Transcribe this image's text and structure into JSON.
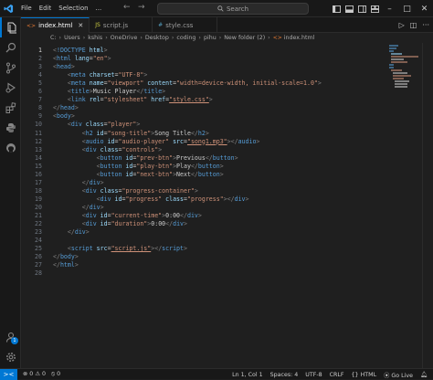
{
  "titlebar": {
    "menu": [
      "File",
      "Edit",
      "Selection"
    ],
    "more_label": "...",
    "back_label": "←",
    "forward_label": "→",
    "search_label": "Search"
  },
  "tabs": [
    {
      "label": "index.html",
      "icon": "<>",
      "icon_color": "#e37933",
      "active": true
    },
    {
      "label": "script.js",
      "icon": "JS",
      "icon_color": "#cbcb41",
      "active": false
    },
    {
      "label": "style.css",
      "icon": "#",
      "icon_color": "#519aba",
      "active": false
    }
  ],
  "breadcrumb": {
    "parts": [
      "C:",
      "Users",
      "kshis",
      "OneDrive",
      "Desktop",
      "coding",
      "pihu",
      "New folder (2)"
    ],
    "file_icon": "<>",
    "file": "index.html"
  },
  "editor": {
    "cursor_line": 1,
    "line_numbers": [
      "1",
      "2",
      "3",
      "4",
      "5",
      "6",
      "7",
      "8",
      "9",
      "10",
      "11",
      "12",
      "13",
      "14",
      "15",
      "16",
      "17",
      "18",
      "19",
      "20",
      "21",
      "22",
      "23",
      "24",
      "25",
      "26",
      "27",
      "28"
    ],
    "lines": [
      [
        {
          "k": "t-punc",
          "t": "<"
        },
        {
          "k": "t-doc",
          "t": "!DOCTYPE"
        },
        {
          "k": "t-attr",
          "t": " html"
        },
        {
          "k": "t-punc",
          "t": ">"
        }
      ],
      [
        {
          "k": "t-punc",
          "t": "<"
        },
        {
          "k": "t-tag",
          "t": "html"
        },
        {
          "k": "t-attr",
          "t": " lang"
        },
        {
          "k": "t-txt",
          "t": "="
        },
        {
          "k": "t-str",
          "t": "\"en\""
        },
        {
          "k": "t-punc",
          "t": ">"
        }
      ],
      [
        {
          "k": "t-punc",
          "t": "<"
        },
        {
          "k": "t-tag",
          "t": "head"
        },
        {
          "k": "t-punc",
          "t": ">"
        }
      ],
      [
        {
          "k": "t-txt",
          "t": "    "
        },
        {
          "k": "t-punc",
          "t": "<"
        },
        {
          "k": "t-tag",
          "t": "meta"
        },
        {
          "k": "t-attr",
          "t": " charset"
        },
        {
          "k": "t-txt",
          "t": "="
        },
        {
          "k": "t-str",
          "t": "\"UTF-8\""
        },
        {
          "k": "t-punc",
          "t": ">"
        }
      ],
      [
        {
          "k": "t-txt",
          "t": "    "
        },
        {
          "k": "t-punc",
          "t": "<"
        },
        {
          "k": "t-tag",
          "t": "meta"
        },
        {
          "k": "t-attr",
          "t": " name"
        },
        {
          "k": "t-txt",
          "t": "="
        },
        {
          "k": "t-str",
          "t": "\"viewport\""
        },
        {
          "k": "t-attr",
          "t": " content"
        },
        {
          "k": "t-txt",
          "t": "="
        },
        {
          "k": "t-str",
          "t": "\"width=device-width, initial-scale=1.0\""
        },
        {
          "k": "t-punc",
          "t": ">"
        }
      ],
      [
        {
          "k": "t-txt",
          "t": "    "
        },
        {
          "k": "t-punc",
          "t": "<"
        },
        {
          "k": "t-tag",
          "t": "title"
        },
        {
          "k": "t-punc",
          "t": ">"
        },
        {
          "k": "t-txt",
          "t": "Music Player"
        },
        {
          "k": "t-punc",
          "t": "</"
        },
        {
          "k": "t-tag",
          "t": "title"
        },
        {
          "k": "t-punc",
          "t": ">"
        }
      ],
      [
        {
          "k": "t-txt",
          "t": "    "
        },
        {
          "k": "t-punc",
          "t": "<"
        },
        {
          "k": "t-tag",
          "t": "link"
        },
        {
          "k": "t-attr",
          "t": " rel"
        },
        {
          "k": "t-txt",
          "t": "="
        },
        {
          "k": "t-str",
          "t": "\"stylesheet\""
        },
        {
          "k": "t-attr",
          "t": " href"
        },
        {
          "k": "t-txt",
          "t": "="
        },
        {
          "k": "t-str t-link",
          "t": "\"style.css\""
        },
        {
          "k": "t-punc",
          "t": ">"
        }
      ],
      [
        {
          "k": "t-punc",
          "t": "</"
        },
        {
          "k": "t-tag",
          "t": "head"
        },
        {
          "k": "t-punc",
          "t": ">"
        }
      ],
      [
        {
          "k": "t-punc",
          "t": "<"
        },
        {
          "k": "t-tag",
          "t": "body"
        },
        {
          "k": "t-punc",
          "t": ">"
        }
      ],
      [
        {
          "k": "t-txt",
          "t": "    "
        },
        {
          "k": "t-punc",
          "t": "<"
        },
        {
          "k": "t-tag",
          "t": "div"
        },
        {
          "k": "t-attr",
          "t": " class"
        },
        {
          "k": "t-txt",
          "t": "="
        },
        {
          "k": "t-str",
          "t": "\"player\""
        },
        {
          "k": "t-punc",
          "t": ">"
        }
      ],
      [
        {
          "k": "t-txt",
          "t": "        "
        },
        {
          "k": "t-punc",
          "t": "<"
        },
        {
          "k": "t-tag",
          "t": "h2"
        },
        {
          "k": "t-attr",
          "t": " id"
        },
        {
          "k": "t-txt",
          "t": "="
        },
        {
          "k": "t-str",
          "t": "\"song-title\""
        },
        {
          "k": "t-punc",
          "t": ">"
        },
        {
          "k": "t-txt",
          "t": "Song Title"
        },
        {
          "k": "t-punc",
          "t": "</"
        },
        {
          "k": "t-tag",
          "t": "h2"
        },
        {
          "k": "t-punc",
          "t": ">"
        }
      ],
      [
        {
          "k": "t-txt",
          "t": "        "
        },
        {
          "k": "t-punc",
          "t": "<"
        },
        {
          "k": "t-tag",
          "t": "audio"
        },
        {
          "k": "t-attr",
          "t": " id"
        },
        {
          "k": "t-txt",
          "t": "="
        },
        {
          "k": "t-str",
          "t": "\"audio-player\""
        },
        {
          "k": "t-attr",
          "t": " src"
        },
        {
          "k": "t-txt",
          "t": "="
        },
        {
          "k": "t-str t-link",
          "t": "\"song1.mp3\""
        },
        {
          "k": "t-punc",
          "t": "></"
        },
        {
          "k": "t-tag",
          "t": "audio"
        },
        {
          "k": "t-punc",
          "t": ">"
        }
      ],
      [
        {
          "k": "t-txt",
          "t": "        "
        },
        {
          "k": "t-punc",
          "t": "<"
        },
        {
          "k": "t-tag",
          "t": "div"
        },
        {
          "k": "t-attr",
          "t": " class"
        },
        {
          "k": "t-txt",
          "t": "="
        },
        {
          "k": "t-str",
          "t": "\"controls\""
        },
        {
          "k": "t-punc",
          "t": ">"
        }
      ],
      [
        {
          "k": "t-txt",
          "t": "            "
        },
        {
          "k": "t-punc",
          "t": "<"
        },
        {
          "k": "t-tag",
          "t": "button"
        },
        {
          "k": "t-attr",
          "t": " id"
        },
        {
          "k": "t-txt",
          "t": "="
        },
        {
          "k": "t-str",
          "t": "\"prev-btn\""
        },
        {
          "k": "t-punc",
          "t": ">"
        },
        {
          "k": "t-txt",
          "t": "Previous"
        },
        {
          "k": "t-punc",
          "t": "</"
        },
        {
          "k": "t-tag",
          "t": "button"
        },
        {
          "k": "t-punc",
          "t": ">"
        }
      ],
      [
        {
          "k": "t-txt",
          "t": "            "
        },
        {
          "k": "t-punc",
          "t": "<"
        },
        {
          "k": "t-tag",
          "t": "button"
        },
        {
          "k": "t-attr",
          "t": " id"
        },
        {
          "k": "t-txt",
          "t": "="
        },
        {
          "k": "t-str",
          "t": "\"play-btn\""
        },
        {
          "k": "t-punc",
          "t": ">"
        },
        {
          "k": "t-txt",
          "t": "Play"
        },
        {
          "k": "t-punc",
          "t": "</"
        },
        {
          "k": "t-tag",
          "t": "button"
        },
        {
          "k": "t-punc",
          "t": ">"
        }
      ],
      [
        {
          "k": "t-txt",
          "t": "            "
        },
        {
          "k": "t-punc",
          "t": "<"
        },
        {
          "k": "t-tag",
          "t": "button"
        },
        {
          "k": "t-attr",
          "t": " id"
        },
        {
          "k": "t-txt",
          "t": "="
        },
        {
          "k": "t-str",
          "t": "\"next-btn\""
        },
        {
          "k": "t-punc",
          "t": ">"
        },
        {
          "k": "t-txt",
          "t": "Next"
        },
        {
          "k": "t-punc",
          "t": "</"
        },
        {
          "k": "t-tag",
          "t": "button"
        },
        {
          "k": "t-punc",
          "t": ">"
        }
      ],
      [
        {
          "k": "t-txt",
          "t": "        "
        },
        {
          "k": "t-punc",
          "t": "</"
        },
        {
          "k": "t-tag",
          "t": "div"
        },
        {
          "k": "t-punc",
          "t": ">"
        }
      ],
      [
        {
          "k": "t-txt",
          "t": "        "
        },
        {
          "k": "t-punc",
          "t": "<"
        },
        {
          "k": "t-tag",
          "t": "div"
        },
        {
          "k": "t-attr",
          "t": " class"
        },
        {
          "k": "t-txt",
          "t": "="
        },
        {
          "k": "t-str",
          "t": "\"progress-container\""
        },
        {
          "k": "t-punc",
          "t": ">"
        }
      ],
      [
        {
          "k": "t-txt",
          "t": "            "
        },
        {
          "k": "t-punc",
          "t": "<"
        },
        {
          "k": "t-tag",
          "t": "div"
        },
        {
          "k": "t-attr",
          "t": " id"
        },
        {
          "k": "t-txt",
          "t": "="
        },
        {
          "k": "t-str",
          "t": "\"progress\""
        },
        {
          "k": "t-attr",
          "t": " class"
        },
        {
          "k": "t-txt",
          "t": "="
        },
        {
          "k": "t-str",
          "t": "\"progress\""
        },
        {
          "k": "t-punc",
          "t": "></"
        },
        {
          "k": "t-tag",
          "t": "div"
        },
        {
          "k": "t-punc",
          "t": ">"
        }
      ],
      [
        {
          "k": "t-txt",
          "t": "        "
        },
        {
          "k": "t-punc",
          "t": "</"
        },
        {
          "k": "t-tag",
          "t": "div"
        },
        {
          "k": "t-punc",
          "t": ">"
        }
      ],
      [
        {
          "k": "t-txt",
          "t": "        "
        },
        {
          "k": "t-punc",
          "t": "<"
        },
        {
          "k": "t-tag",
          "t": "div"
        },
        {
          "k": "t-attr",
          "t": " id"
        },
        {
          "k": "t-txt",
          "t": "="
        },
        {
          "k": "t-str",
          "t": "\"current-time\""
        },
        {
          "k": "t-punc",
          "t": ">"
        },
        {
          "k": "t-txt",
          "t": "0:00"
        },
        {
          "k": "t-punc",
          "t": "</"
        },
        {
          "k": "t-tag",
          "t": "div"
        },
        {
          "k": "t-punc",
          "t": ">"
        }
      ],
      [
        {
          "k": "t-txt",
          "t": "        "
        },
        {
          "k": "t-punc",
          "t": "<"
        },
        {
          "k": "t-tag",
          "t": "div"
        },
        {
          "k": "t-attr",
          "t": " id"
        },
        {
          "k": "t-txt",
          "t": "="
        },
        {
          "k": "t-str",
          "t": "\"duration\""
        },
        {
          "k": "t-punc",
          "t": ">"
        },
        {
          "k": "t-txt",
          "t": "0:00"
        },
        {
          "k": "t-punc",
          "t": "</"
        },
        {
          "k": "t-tag",
          "t": "div"
        },
        {
          "k": "t-punc",
          "t": ">"
        }
      ],
      [
        {
          "k": "t-txt",
          "t": "    "
        },
        {
          "k": "t-punc",
          "t": "</"
        },
        {
          "k": "t-tag",
          "t": "div"
        },
        {
          "k": "t-punc",
          "t": ">"
        }
      ],
      [],
      [
        {
          "k": "t-txt",
          "t": "    "
        },
        {
          "k": "t-punc",
          "t": "<"
        },
        {
          "k": "t-tag",
          "t": "script"
        },
        {
          "k": "t-attr",
          "t": " src"
        },
        {
          "k": "t-txt",
          "t": "="
        },
        {
          "k": "t-str t-link",
          "t": "\"script.js\""
        },
        {
          "k": "t-punc",
          "t": "></"
        },
        {
          "k": "t-tag",
          "t": "script"
        },
        {
          "k": "t-punc",
          "t": ">"
        }
      ],
      [
        {
          "k": "t-punc",
          "t": "</"
        },
        {
          "k": "t-tag",
          "t": "body"
        },
        {
          "k": "t-punc",
          "t": ">"
        }
      ],
      [
        {
          "k": "t-punc",
          "t": "</"
        },
        {
          "k": "t-tag",
          "t": "html"
        },
        {
          "k": "t-punc",
          "t": ">"
        }
      ],
      []
    ]
  },
  "statusbar": {
    "remote_icon": "><",
    "errors": "0",
    "warnings": "0",
    "ports": "0",
    "position": "Ln 1, Col 1",
    "spaces": "Spaces: 4",
    "encoding": "UTF-8",
    "eol": "CRLF",
    "language": "HTML",
    "golive": "Go Live"
  },
  "activity": {
    "account_badge": "1"
  },
  "colors": {
    "accent": "#0078d4",
    "background": "#1f1f1f",
    "chrome": "#181818"
  }
}
